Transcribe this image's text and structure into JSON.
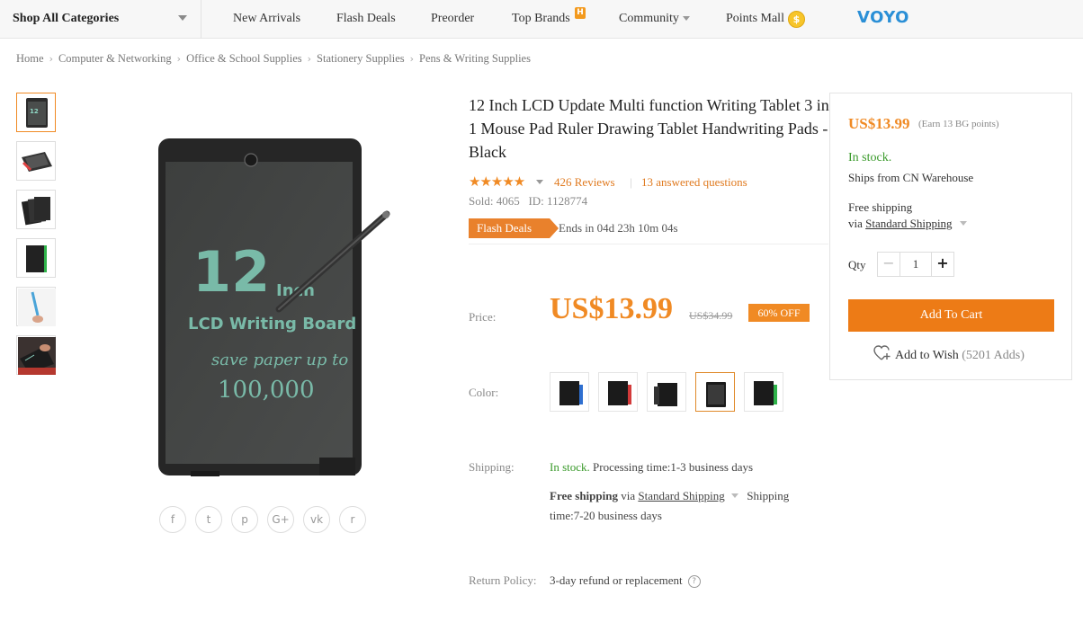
{
  "nav": {
    "categories_label": "Shop All Categories",
    "items": [
      "New Arrivals",
      "Flash Deals",
      "Preorder",
      "Top Brands",
      "Community",
      "Points Mall"
    ],
    "top_brands_badge": "H",
    "coin_symbol": "$",
    "logo": "VOYO"
  },
  "breadcrumb": [
    "Home",
    "Computer & Networking",
    "Office & School Supplies",
    "Stationery Supplies",
    "Pens & Writing Supplies"
  ],
  "product": {
    "title": "12 Inch LCD Update Multi function Writing Tablet 3 in 1 Mouse Pad Ruler Drawing Tablet Handwriting Pads - Black",
    "rating": 4.5,
    "reviews": "426 Reviews",
    "questions": "13 answered questions",
    "sold": "Sold: 4065",
    "id": "ID: 1128774",
    "flash_label": "Flash Deals",
    "ends_in": "Ends in 04d 23h 10m 04s",
    "price_label": "Price:",
    "price": "US$13.99",
    "old_price": "US$34.99",
    "discount": "60% OFF",
    "color_label": "Color:",
    "colors": [
      "blue",
      "red",
      "black",
      "black",
      "green"
    ],
    "selected_color_index": 3,
    "shipping_label": "Shipping:",
    "in_stock": "In stock.",
    "processing": "Processing time:1-3 business days",
    "free_shipping": "Free shipping",
    "via": "via",
    "method": "Standard Shipping",
    "shipping_word": "Shipping",
    "shipping_time": "time:7-20 business days",
    "return_label": "Return Policy:",
    "return_text": "3-day refund or replacement",
    "board_text": [
      "12",
      "Inch",
      "LCD Writing Board",
      "save paper up to",
      "100,000"
    ]
  },
  "buybox": {
    "price": "US$13.99",
    "earn": "(Earn 13 BG points)",
    "in_stock": "In stock.",
    "ships_from": "Ships from CN Warehouse",
    "free_shipping": "Free shipping",
    "via": "via",
    "method": "Standard Shipping",
    "qty_label": "Qty",
    "qty": "1",
    "minus": "−",
    "plus": "+",
    "add_to_cart": "Add To Cart",
    "wish_label": "Add to Wish",
    "wish_count": "(5201 Adds)"
  },
  "share_icons": [
    "f",
    "t",
    "p",
    "G+",
    "vk",
    "r"
  ],
  "colors": {
    "accent": "#f08a24",
    "cart": "#ed7b16",
    "stock": "#3a9a2b"
  }
}
